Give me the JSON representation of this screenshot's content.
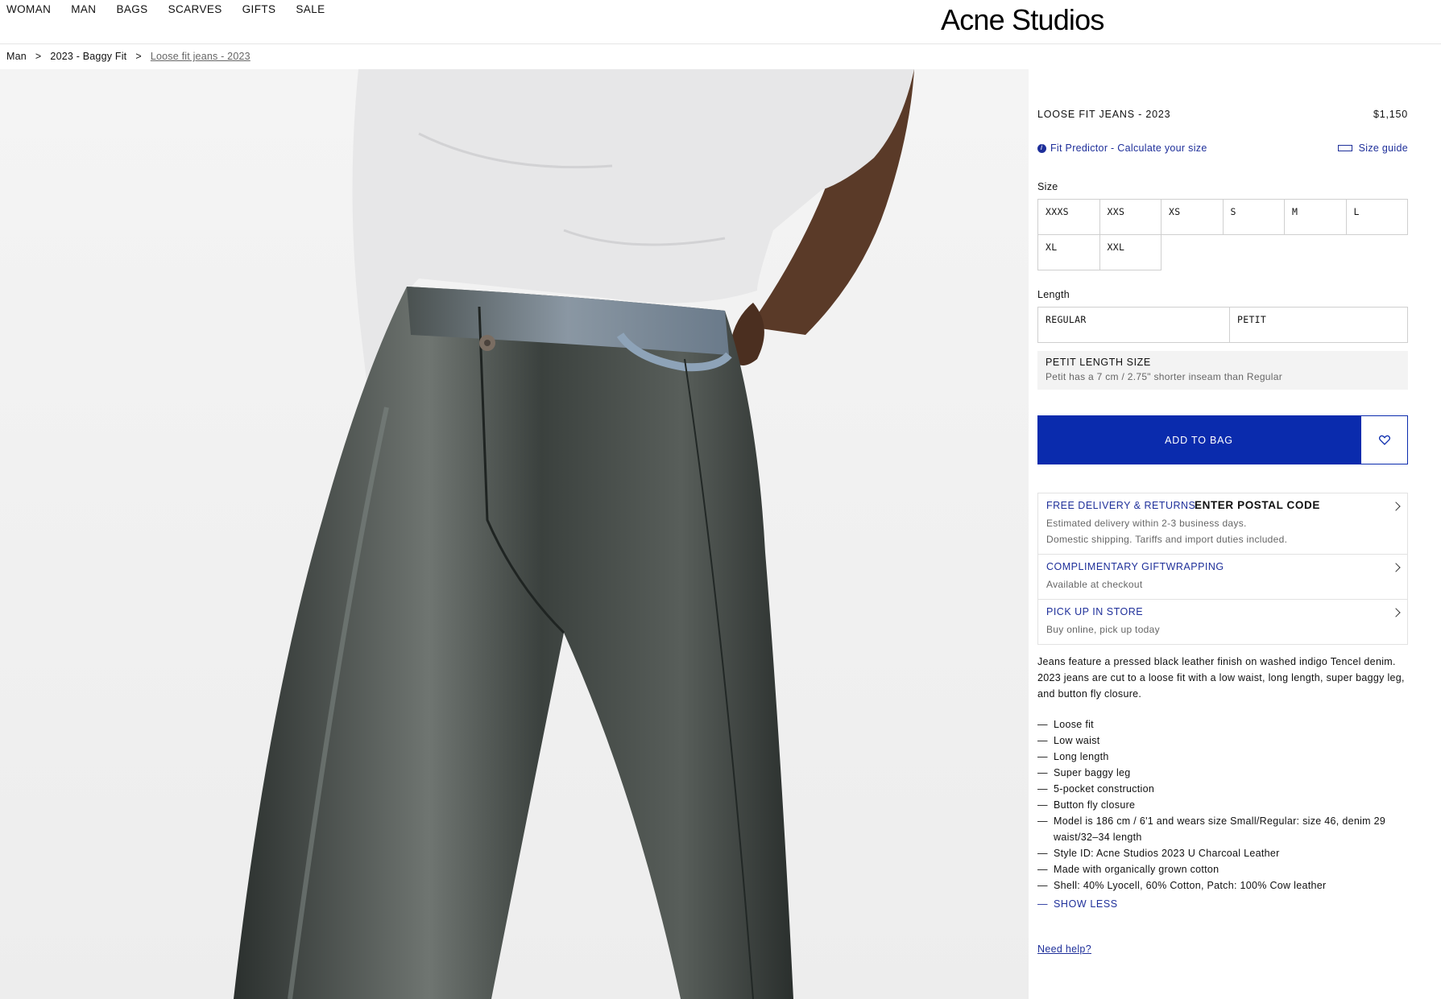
{
  "nav": {
    "items": [
      "WOMAN",
      "MAN",
      "BAGS",
      "SCARVES",
      "GIFTS",
      "SALE"
    ],
    "logo": "Acne Studios"
  },
  "breadcrumb": {
    "items": [
      "Man",
      "2023 - Baggy Fit",
      "Loose fit jeans - 2023"
    ],
    "separator": ">"
  },
  "product": {
    "name": "LOOSE FIT JEANS - 2023",
    "price": "$1,150",
    "fit_predictor": "Fit Predictor - Calculate your size",
    "size_guide": "Size guide",
    "size_label": "Size",
    "sizes": [
      "XXXS",
      "XXS",
      "XS",
      "S",
      "M",
      "L",
      "XL",
      "XXL"
    ],
    "length_label": "Length",
    "lengths": [
      "REGULAR",
      "PETIT"
    ],
    "petit_title": "PETIT LENGTH SIZE",
    "petit_desc": "Petit has a 7 cm / 2.75\" shorter inseam than Regular",
    "add_to_bag": "ADD TO BAG"
  },
  "info": {
    "delivery_title": "FREE DELIVERY & RETURNS",
    "postal": "ENTER POSTAL CODE",
    "delivery_line1": "Estimated delivery within 2-3 business days.",
    "delivery_line2": "Domestic shipping. Tariffs and import duties included.",
    "gift_title": "COMPLIMENTARY GIFTWRAPPING",
    "gift_desc": "Available at checkout",
    "pickup_title": "PICK UP IN STORE",
    "pickup_desc": "Buy online, pick up today"
  },
  "description": "Jeans feature a pressed black leather finish on washed indigo Tencel denim. 2023 jeans are cut to a loose fit with a low waist, long length, super baggy leg, and button fly closure.",
  "features": [
    "Loose fit",
    "Low waist",
    "Long length",
    "Super baggy leg",
    "5-pocket construction",
    "Button fly closure",
    "Model is 186 cm / 6'1 and wears size Small/Regular: size 46, denim 29 waist/32–34 length",
    "Style ID: Acne Studios 2023 U Charcoal Leather",
    "Made with organically grown cotton",
    "Shell: 40% Lyocell, 60% Cotton, Patch: 100% Cow leather"
  ],
  "show_less": "SHOW LESS",
  "need_help": "Need help?",
  "colors": {
    "accent": "#0a2bad",
    "link": "#1e2f9a"
  }
}
